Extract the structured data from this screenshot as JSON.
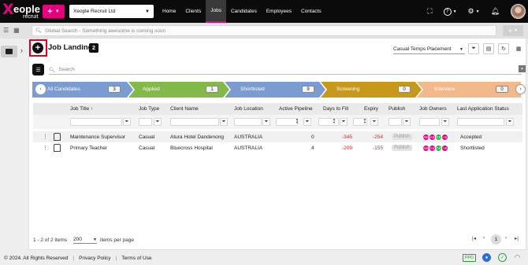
{
  "brand": {
    "logo_x": "X",
    "logo_text": "eople",
    "logo_sub": "recruit",
    "accent": "#e5007e"
  },
  "topnav": {
    "company": "Xeople Recruit Ltd",
    "items": [
      "Home",
      "Clients",
      "Jobs",
      "Candidates",
      "Employees",
      "Contacts"
    ],
    "active": "Jobs"
  },
  "secbar": {
    "search_placeholder": "Global Search - Something awesome is coming soon"
  },
  "page": {
    "title": "Job Landing",
    "count": "2",
    "placement": "Casual Temps Placement",
    "search_placeholder": "Search"
  },
  "pipeline": [
    {
      "label": "All Candidates",
      "count": "3",
      "color": "#7b9cd0"
    },
    {
      "label": "Applied",
      "count": "1",
      "color": "#83b84a"
    },
    {
      "label": "Shortlisted",
      "count": "9",
      "color": "#7b9cd0"
    },
    {
      "label": "Screening",
      "count": "0",
      "color": "#c8981a"
    },
    {
      "label": "Interview",
      "count": "0",
      "color": "#f2b98c"
    }
  ],
  "table": {
    "headers": {
      "title": "Job Title",
      "type": "Job Type",
      "client": "Client Name",
      "location": "Job Location",
      "pipeline": "Active Pipeline",
      "days": "Days to Fill",
      "expiry": "Expiry",
      "publish": "Publish",
      "owners": "Job Owners",
      "status": "Last Application Status"
    },
    "rows": [
      {
        "title": "Maintenance Supervisor",
        "type": "Casual",
        "client": "Atura Hotel Dandenong",
        "location": "AUSTRALIA",
        "pipeline": "0",
        "days": "-345",
        "expiry": "-254",
        "publish": "Publish",
        "owners": [
          "AM",
          "AS",
          "GS",
          "+6"
        ],
        "status": "Accepted"
      },
      {
        "title": "Primary Teacher",
        "type": "Casual",
        "client": "Bluecross Hospital",
        "location": "AUSTRALIA",
        "pipeline": "4",
        "days": "-209",
        "expiry": "-155",
        "publish": "Publish",
        "owners": [
          "AM",
          "AS",
          "GS",
          "+6"
        ],
        "status": "Shortlisted"
      }
    ]
  },
  "pager": {
    "summary": "1 - 2 of 2 items",
    "page_size": "200",
    "items_per_page": "items per page",
    "current": "1"
  },
  "footer": {
    "copyright": "© 2024. All Rights Reserved",
    "privacy": "Privacy Policy",
    "terms": "Terms of Use",
    "ppd": "PPD"
  }
}
